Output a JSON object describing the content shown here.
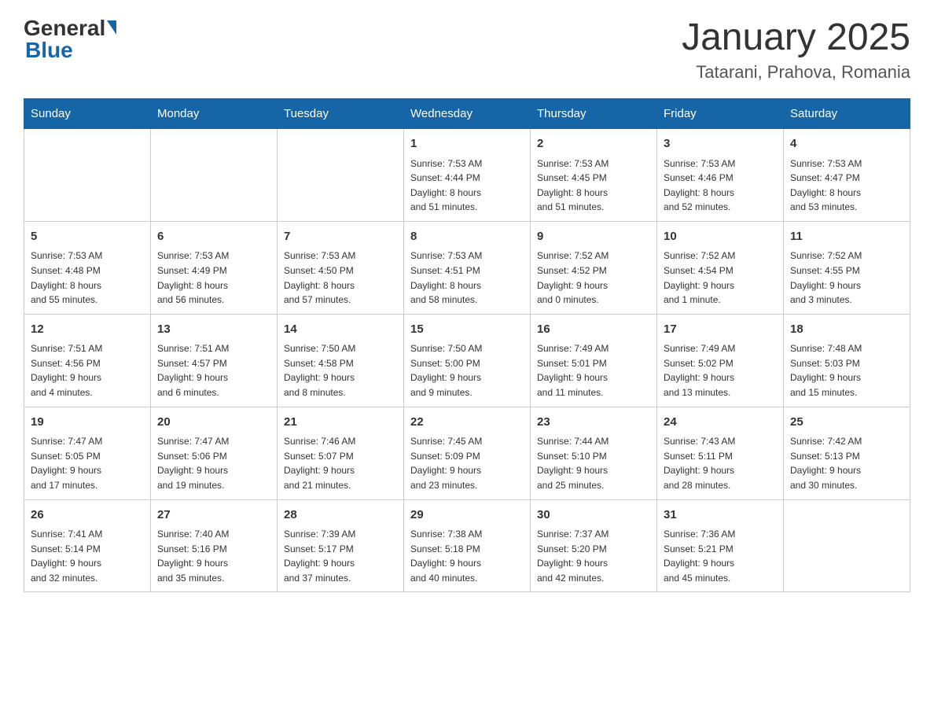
{
  "logo": {
    "general": "General",
    "blue": "Blue"
  },
  "title": "January 2025",
  "location": "Tatarani, Prahova, Romania",
  "days_of_week": [
    "Sunday",
    "Monday",
    "Tuesday",
    "Wednesday",
    "Thursday",
    "Friday",
    "Saturday"
  ],
  "weeks": [
    [
      {
        "day": "",
        "info": ""
      },
      {
        "day": "",
        "info": ""
      },
      {
        "day": "",
        "info": ""
      },
      {
        "day": "1",
        "info": "Sunrise: 7:53 AM\nSunset: 4:44 PM\nDaylight: 8 hours\nand 51 minutes."
      },
      {
        "day": "2",
        "info": "Sunrise: 7:53 AM\nSunset: 4:45 PM\nDaylight: 8 hours\nand 51 minutes."
      },
      {
        "day": "3",
        "info": "Sunrise: 7:53 AM\nSunset: 4:46 PM\nDaylight: 8 hours\nand 52 minutes."
      },
      {
        "day": "4",
        "info": "Sunrise: 7:53 AM\nSunset: 4:47 PM\nDaylight: 8 hours\nand 53 minutes."
      }
    ],
    [
      {
        "day": "5",
        "info": "Sunrise: 7:53 AM\nSunset: 4:48 PM\nDaylight: 8 hours\nand 55 minutes."
      },
      {
        "day": "6",
        "info": "Sunrise: 7:53 AM\nSunset: 4:49 PM\nDaylight: 8 hours\nand 56 minutes."
      },
      {
        "day": "7",
        "info": "Sunrise: 7:53 AM\nSunset: 4:50 PM\nDaylight: 8 hours\nand 57 minutes."
      },
      {
        "day": "8",
        "info": "Sunrise: 7:53 AM\nSunset: 4:51 PM\nDaylight: 8 hours\nand 58 minutes."
      },
      {
        "day": "9",
        "info": "Sunrise: 7:52 AM\nSunset: 4:52 PM\nDaylight: 9 hours\nand 0 minutes."
      },
      {
        "day": "10",
        "info": "Sunrise: 7:52 AM\nSunset: 4:54 PM\nDaylight: 9 hours\nand 1 minute."
      },
      {
        "day": "11",
        "info": "Sunrise: 7:52 AM\nSunset: 4:55 PM\nDaylight: 9 hours\nand 3 minutes."
      }
    ],
    [
      {
        "day": "12",
        "info": "Sunrise: 7:51 AM\nSunset: 4:56 PM\nDaylight: 9 hours\nand 4 minutes."
      },
      {
        "day": "13",
        "info": "Sunrise: 7:51 AM\nSunset: 4:57 PM\nDaylight: 9 hours\nand 6 minutes."
      },
      {
        "day": "14",
        "info": "Sunrise: 7:50 AM\nSunset: 4:58 PM\nDaylight: 9 hours\nand 8 minutes."
      },
      {
        "day": "15",
        "info": "Sunrise: 7:50 AM\nSunset: 5:00 PM\nDaylight: 9 hours\nand 9 minutes."
      },
      {
        "day": "16",
        "info": "Sunrise: 7:49 AM\nSunset: 5:01 PM\nDaylight: 9 hours\nand 11 minutes."
      },
      {
        "day": "17",
        "info": "Sunrise: 7:49 AM\nSunset: 5:02 PM\nDaylight: 9 hours\nand 13 minutes."
      },
      {
        "day": "18",
        "info": "Sunrise: 7:48 AM\nSunset: 5:03 PM\nDaylight: 9 hours\nand 15 minutes."
      }
    ],
    [
      {
        "day": "19",
        "info": "Sunrise: 7:47 AM\nSunset: 5:05 PM\nDaylight: 9 hours\nand 17 minutes."
      },
      {
        "day": "20",
        "info": "Sunrise: 7:47 AM\nSunset: 5:06 PM\nDaylight: 9 hours\nand 19 minutes."
      },
      {
        "day": "21",
        "info": "Sunrise: 7:46 AM\nSunset: 5:07 PM\nDaylight: 9 hours\nand 21 minutes."
      },
      {
        "day": "22",
        "info": "Sunrise: 7:45 AM\nSunset: 5:09 PM\nDaylight: 9 hours\nand 23 minutes."
      },
      {
        "day": "23",
        "info": "Sunrise: 7:44 AM\nSunset: 5:10 PM\nDaylight: 9 hours\nand 25 minutes."
      },
      {
        "day": "24",
        "info": "Sunrise: 7:43 AM\nSunset: 5:11 PM\nDaylight: 9 hours\nand 28 minutes."
      },
      {
        "day": "25",
        "info": "Sunrise: 7:42 AM\nSunset: 5:13 PM\nDaylight: 9 hours\nand 30 minutes."
      }
    ],
    [
      {
        "day": "26",
        "info": "Sunrise: 7:41 AM\nSunset: 5:14 PM\nDaylight: 9 hours\nand 32 minutes."
      },
      {
        "day": "27",
        "info": "Sunrise: 7:40 AM\nSunset: 5:16 PM\nDaylight: 9 hours\nand 35 minutes."
      },
      {
        "day": "28",
        "info": "Sunrise: 7:39 AM\nSunset: 5:17 PM\nDaylight: 9 hours\nand 37 minutes."
      },
      {
        "day": "29",
        "info": "Sunrise: 7:38 AM\nSunset: 5:18 PM\nDaylight: 9 hours\nand 40 minutes."
      },
      {
        "day": "30",
        "info": "Sunrise: 7:37 AM\nSunset: 5:20 PM\nDaylight: 9 hours\nand 42 minutes."
      },
      {
        "day": "31",
        "info": "Sunrise: 7:36 AM\nSunset: 5:21 PM\nDaylight: 9 hours\nand 45 minutes."
      },
      {
        "day": "",
        "info": ""
      }
    ]
  ]
}
